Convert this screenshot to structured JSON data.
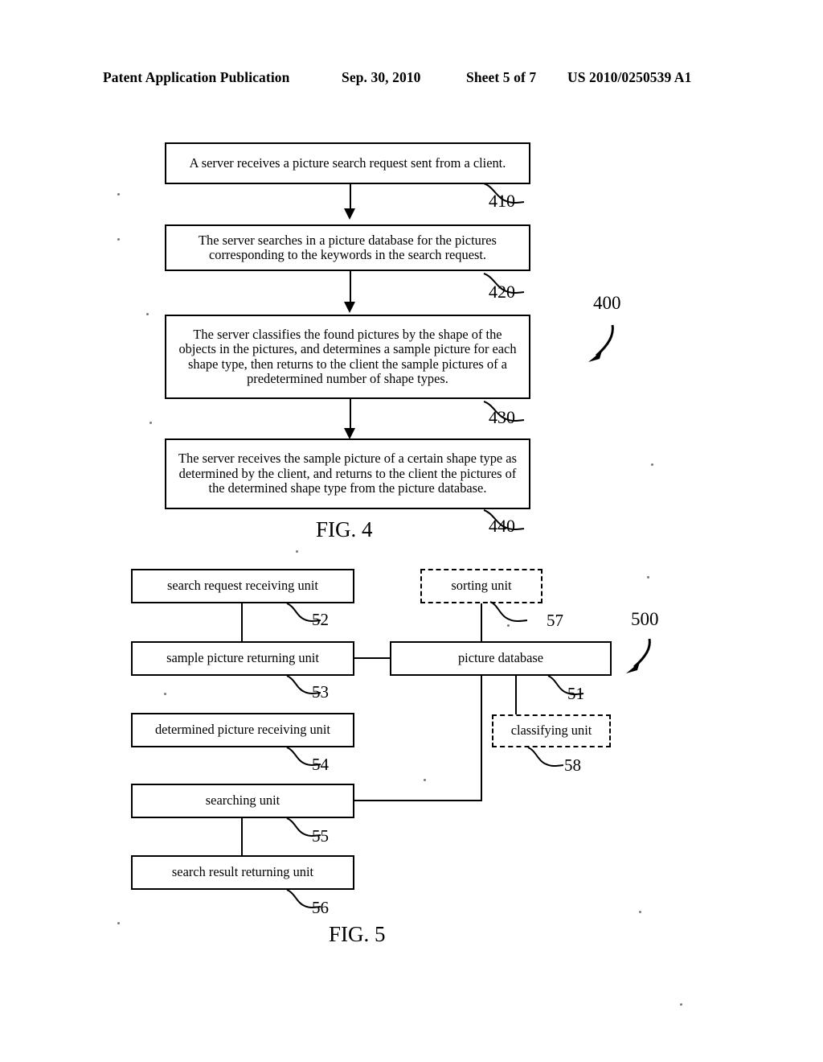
{
  "header": {
    "publication": "Patent Application Publication",
    "date": "Sep. 30, 2010",
    "sheet": "Sheet 5 of 7",
    "number": "US 2010/0250539 A1"
  },
  "figure4": {
    "caption": "FIG. 4",
    "assembly_ref": "400",
    "steps": [
      {
        "ref": "410",
        "text": "A server receives a picture search request sent from a client."
      },
      {
        "ref": "420",
        "text": "The server searches in a picture database for the pictures corresponding to the keywords in the search request."
      },
      {
        "ref": "430",
        "text": "The server classifies the found pictures by the shape of the objects in the pictures, and determines a sample picture for each shape type, then returns to the client the sample pictures of a predetermined number of shape types."
      },
      {
        "ref": "440",
        "text": "The server receives the sample picture of a certain shape type as determined by the client, and returns to the client the pictures of the determined shape type from the picture database."
      }
    ]
  },
  "figure5": {
    "caption": "FIG. 5",
    "assembly_ref": "500",
    "units": {
      "search_request_receiving": {
        "label": "search request receiving unit",
        "ref": "52",
        "style": "solid"
      },
      "sample_picture_returning": {
        "label": "sample picture returning unit",
        "ref": "53",
        "style": "solid"
      },
      "determined_picture_receiving": {
        "label": "determined picture receiving unit",
        "ref": "54",
        "style": "solid"
      },
      "searching": {
        "label": "searching unit",
        "ref": "55",
        "style": "solid"
      },
      "search_result_returning": {
        "label": "search result returning unit",
        "ref": "56",
        "style": "solid"
      },
      "picture_database": {
        "label": "picture database",
        "ref": "51",
        "style": "solid"
      },
      "sorting": {
        "label": "sorting unit",
        "ref": "57",
        "style": "dashed"
      },
      "classifying": {
        "label": "classifying unit",
        "ref": "58",
        "style": "dashed"
      }
    }
  },
  "colors": {
    "ink": "#000000",
    "paper": "#ffffff"
  }
}
